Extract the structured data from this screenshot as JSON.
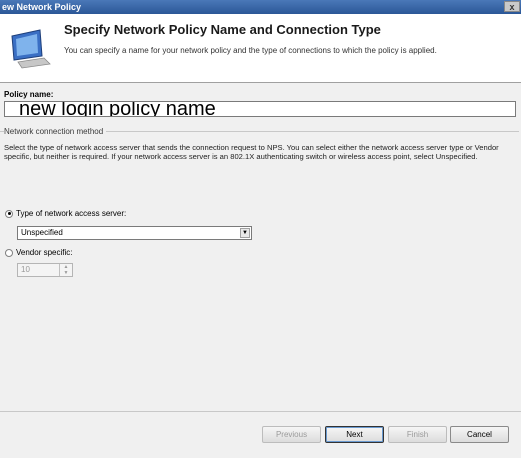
{
  "window": {
    "title": "ew Network Policy",
    "close_glyph": "x"
  },
  "header": {
    "heading": "Specify Network Policy Name and Connection Type",
    "subtitle": "You can specify a name for your network policy and the type of connections to which the policy is applied."
  },
  "policy_name": {
    "label": "Policy name:",
    "value": "new login policy name"
  },
  "connection_method": {
    "legend": "Network connection method",
    "description": "Select the type of network access server that sends the connection request to NPS. You can select either the network access server type or Vendor specific, but neither is required.  If your network access server is an 802.1X authenticating switch or wireless access point, select Unspecified.",
    "type_radio_label": "Type of network access server:",
    "type_selected": "Unspecified",
    "vendor_radio_label": "Vendor specific:",
    "vendor_value": "10"
  },
  "buttons": {
    "previous": "Previous",
    "next": "Next",
    "finish": "Finish",
    "cancel": "Cancel"
  },
  "icons": {
    "wizard": "monitor-wizard-icon",
    "dropdown": "chevron-down-icon",
    "spin_up": "spin-up-icon",
    "spin_down": "spin-down-icon"
  }
}
